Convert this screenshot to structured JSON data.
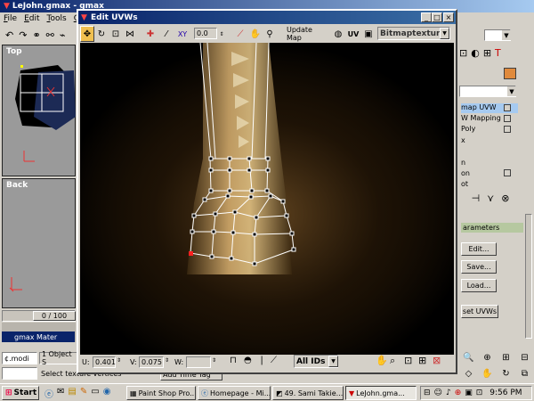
{
  "main_window": {
    "title": "LeJohn.gmax - gmax"
  },
  "menu": [
    "File",
    "Edit",
    "Tools",
    "Gr"
  ],
  "viewports": {
    "top_label": "Top",
    "back_label": "Back",
    "frame_counter": "0 / 100"
  },
  "right_panel": {
    "modifier_stack": [
      "map UVW",
      "W Mapping",
      "Poly",
      "x",
      "n",
      "on",
      "ot"
    ],
    "parameters_header": "arameters",
    "buttons": [
      "Edit...",
      "Save...",
      "Load...",
      "set UVWs"
    ]
  },
  "bottom_panel": {
    "object_field": "1 Object S",
    "gmax_material": "gmax Mater",
    "prompt_text": "Select texture vertices",
    "add_time_tag": "Add Time Tag",
    "script_field": "¢.modi"
  },
  "uv_window": {
    "title": "Edit UVWs",
    "update_map_label": "Update Map",
    "uv_dropdown": "UV",
    "texture_dropdown": "Bitmaptexture",
    "spinner_value": "0.0",
    "u_label": "U:",
    "u_value": "0.401",
    "v_label": "V:",
    "v_value": "0.075",
    "w_label": "W:",
    "w_value": "",
    "ids_dropdown": "All IDs",
    "colors": {
      "selected_vertex": "#ff2020",
      "mesh_lines": "#ffffff",
      "texture": "#c8a060"
    }
  },
  "taskbar": {
    "start_label": "Start",
    "tasks": [
      "Paint Shop Pro...",
      "Homepage - Mi...",
      "49. Sami Takie...",
      "LeJohn.gma..."
    ],
    "clock": "9:56 PM"
  }
}
